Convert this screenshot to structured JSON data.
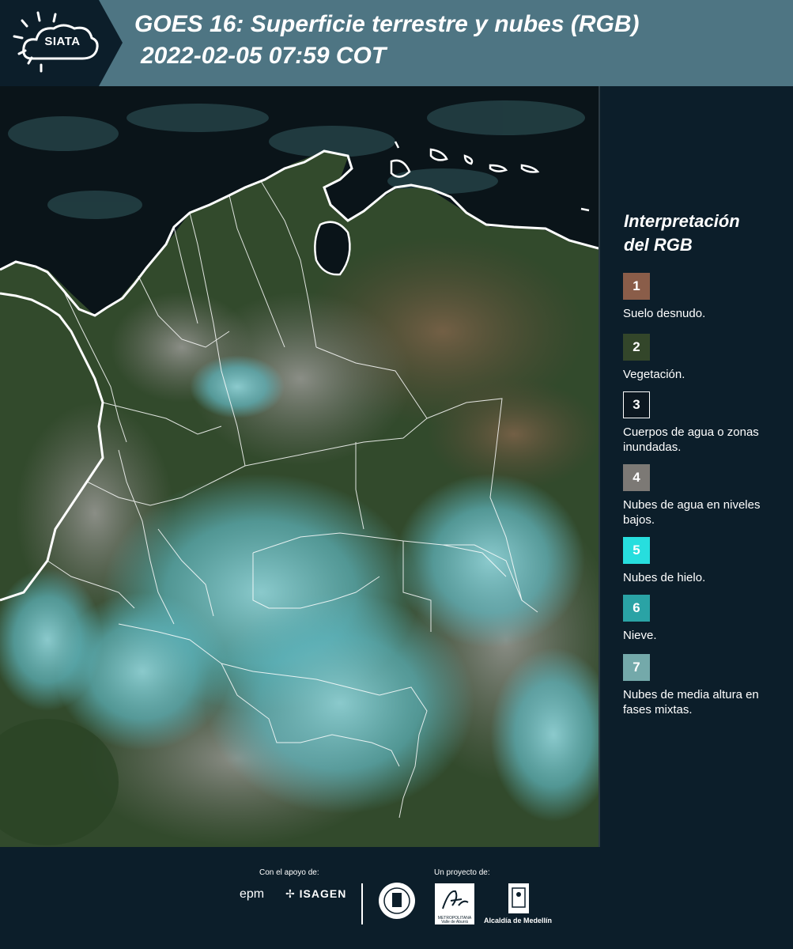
{
  "header": {
    "logo_text": "SIATA",
    "title_line1": "GOES 16: Superficie terrestre y nubes (RGB)",
    "title_line2": "2022-02-05 07:59 COT"
  },
  "legend": {
    "title_line1": "Interpretación",
    "title_line2": "del RGB",
    "items": [
      {
        "number": "1",
        "description": "Suelo desnudo.",
        "color": "#8a5d49"
      },
      {
        "number": "2",
        "description": "Vegetación.",
        "color": "#33462a"
      },
      {
        "number": "3",
        "description": "Cuerpos de agua o zonas inundadas.",
        "color": "#0b1720"
      },
      {
        "number": "4",
        "description": "Nubes de agua en niveles bajos.",
        "color": "#7c7975"
      },
      {
        "number": "5",
        "description": "Nubes de hielo.",
        "color": "#27dede"
      },
      {
        "number": "6",
        "description": "Nieve.",
        "color": "#2aa3a5"
      },
      {
        "number": "7",
        "description": "Nubes de media altura en fases mixtas.",
        "color": "#74a9aa"
      }
    ]
  },
  "footer": {
    "support_label": "Con el apoyo de:",
    "project_label": "Un proyecto de:",
    "epm": "epm",
    "isagen": "ISAGEN",
    "metro": "METROPOLITANA Valle de Aburrá",
    "alcaldia": "Alcaldía de Medellín"
  },
  "colors": {
    "header_bg": "#4e7583",
    "logo_bg": "#0c1e2a",
    "panel_bg": "#0c1e2a",
    "ocean": "#0a1419",
    "vegetation": "#324a2c",
    "bare_soil": "#6a5a46",
    "ice_clouds": "#5fb7c0"
  }
}
